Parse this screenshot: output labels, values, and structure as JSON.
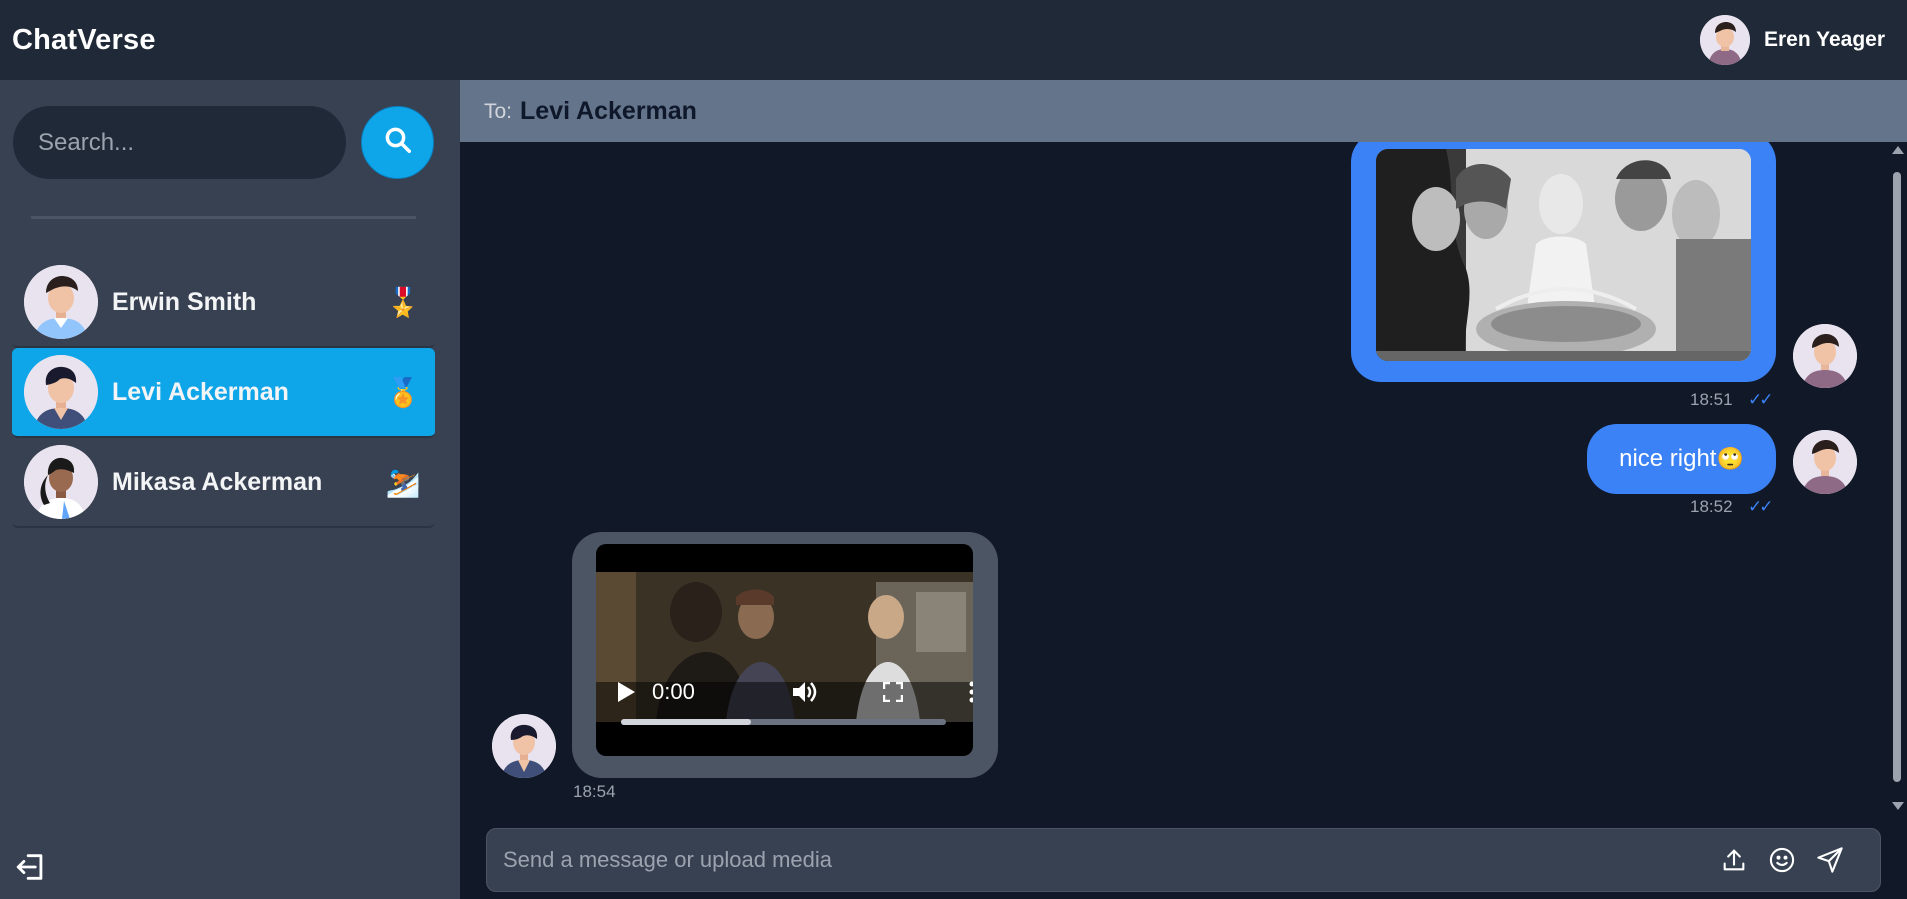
{
  "app": {
    "brand": "ChatVerse"
  },
  "user": {
    "name": "Eren Yeager",
    "avatar_icon": "user-avatar-icon"
  },
  "sidebar": {
    "search": {
      "placeholder": "Search...",
      "button_icon": "search-icon"
    },
    "contacts": [
      {
        "name": "Erwin Smith",
        "badge": "🎖️",
        "active": false
      },
      {
        "name": "Levi Ackerman",
        "badge": "🏅",
        "active": true
      },
      {
        "name": "Mikasa Ackerman",
        "badge": "⛷️",
        "active": false
      }
    ],
    "logout_icon": "logout-icon"
  },
  "chat": {
    "to_label": "To:",
    "recipient": "Levi Ackerman",
    "messages": [
      {
        "type": "image",
        "direction": "sent",
        "time": "18:51",
        "ticks": "✓✓"
      },
      {
        "type": "text",
        "direction": "sent",
        "text": "nice right",
        "emoji": "🙄",
        "time": "18:52",
        "ticks": "✓✓"
      },
      {
        "type": "video",
        "direction": "received",
        "time": "18:54",
        "video_time": "0:00",
        "progress": 0.4
      }
    ],
    "composer": {
      "placeholder": "Send a message or upload media",
      "icons": [
        "upload-icon",
        "emoji-icon",
        "send-icon"
      ]
    }
  },
  "colors": {
    "accent": "#0ea5e9",
    "sent_bubble": "#3b82f6",
    "received_bubble": "#4b5563",
    "header": "#64748b"
  }
}
